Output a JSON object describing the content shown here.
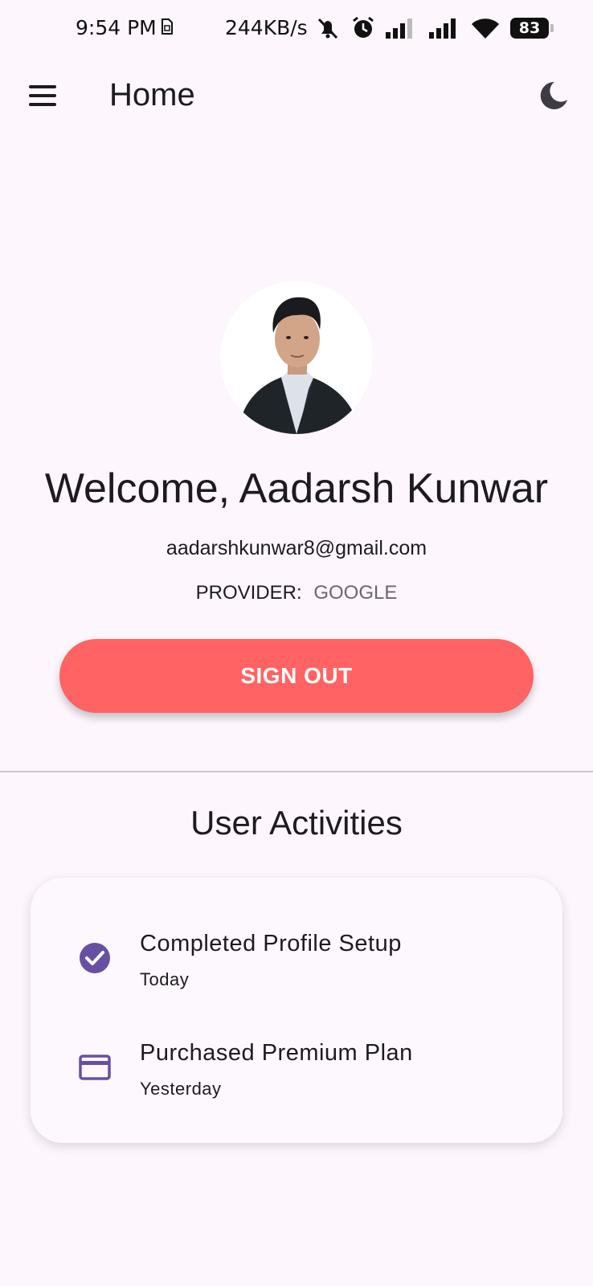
{
  "status_bar": {
    "time": "9:54 PM",
    "network_speed": "244KB/s",
    "battery": "83",
    "icons": [
      "sim-card-icon",
      "mute-icon",
      "alarm-icon",
      "signal-icon",
      "signal-icon",
      "wifi-icon",
      "battery-icon"
    ]
  },
  "app_bar": {
    "title": "Home",
    "menu_icon": "menu-icon",
    "theme_icon": "dark-mode-icon"
  },
  "profile": {
    "welcome": "Welcome, Aadarsh Kunwar",
    "email": "aadarshkunwar8@gmail.com",
    "provider_label": "PROVIDER:",
    "provider_value": "GOOGLE",
    "sign_out_label": "SIGN OUT"
  },
  "activities": {
    "title": "User Activities",
    "items": [
      {
        "title": "Completed Profile Setup",
        "subtitle": "Today",
        "icon": "check-circle-icon"
      },
      {
        "title": "Purchased Premium Plan",
        "subtitle": "Yesterday",
        "icon": "credit-card-icon"
      }
    ]
  },
  "colors": {
    "background": "#fdf7fd",
    "sign_out_button": "#ff6363",
    "accent": "#6750a4"
  }
}
